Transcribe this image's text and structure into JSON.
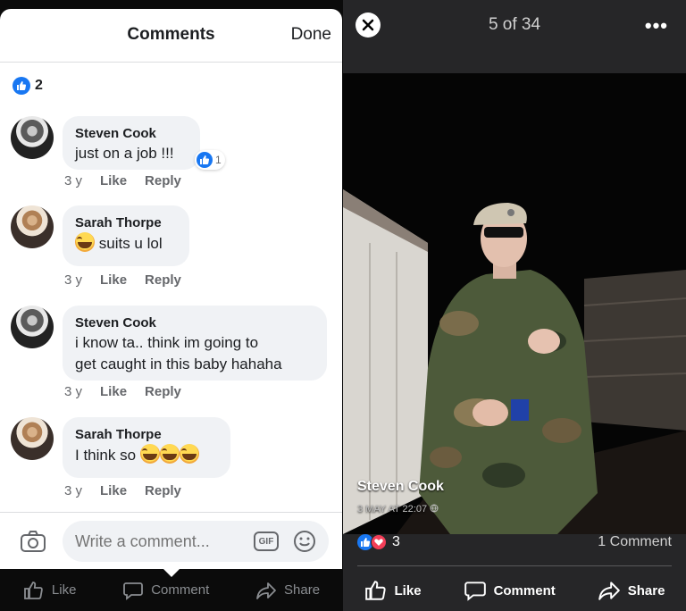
{
  "comments_sheet": {
    "title": "Comments",
    "done_label": "Done",
    "reaction_count": "2",
    "comments": [
      {
        "author": "Steven Cook",
        "text": "just on a job !!!",
        "age": "3 y",
        "like_label": "Like",
        "reply_label": "Reply",
        "reaction_count": "1"
      },
      {
        "author": "Sarah Thorpe",
        "text": "suits u lol",
        "age": "3 y",
        "like_label": "Like",
        "reply_label": "Reply"
      },
      {
        "author": "Steven Cook",
        "text_line1": "i know ta.. think im going to",
        "text_line2": "get caught in this baby hahaha",
        "age": "3 y",
        "like_label": "Like",
        "reply_label": "Reply"
      },
      {
        "author": "Sarah Thorpe",
        "text": "I think so",
        "age": "3 y",
        "like_label": "Like",
        "reply_label": "Reply"
      }
    ],
    "composer": {
      "placeholder": "Write a comment...",
      "gif_label": "GIF"
    }
  },
  "left_actions": {
    "like": "Like",
    "comment": "Comment",
    "share": "Share"
  },
  "photo_viewer": {
    "counter": "5 of 34",
    "more_label": "•••",
    "poster_name": "Steven Cook",
    "post_time": "3 MAY AT 22:07",
    "reaction_count": "3",
    "comments_count": "1 Comment",
    "actions": {
      "like": "Like",
      "comment": "Comment",
      "share": "Share"
    }
  },
  "colors": {
    "facebook_blue": "#1877f2",
    "love_red": "#f33e58",
    "bubble_gray": "#f0f2f5"
  },
  "icons": [
    "like-icon",
    "love-icon",
    "laughing-emoji-icon",
    "camera-icon",
    "gif-icon",
    "emoji-icon",
    "close-icon",
    "more-icon",
    "comment-icon",
    "share-icon",
    "globe-icon"
  ]
}
